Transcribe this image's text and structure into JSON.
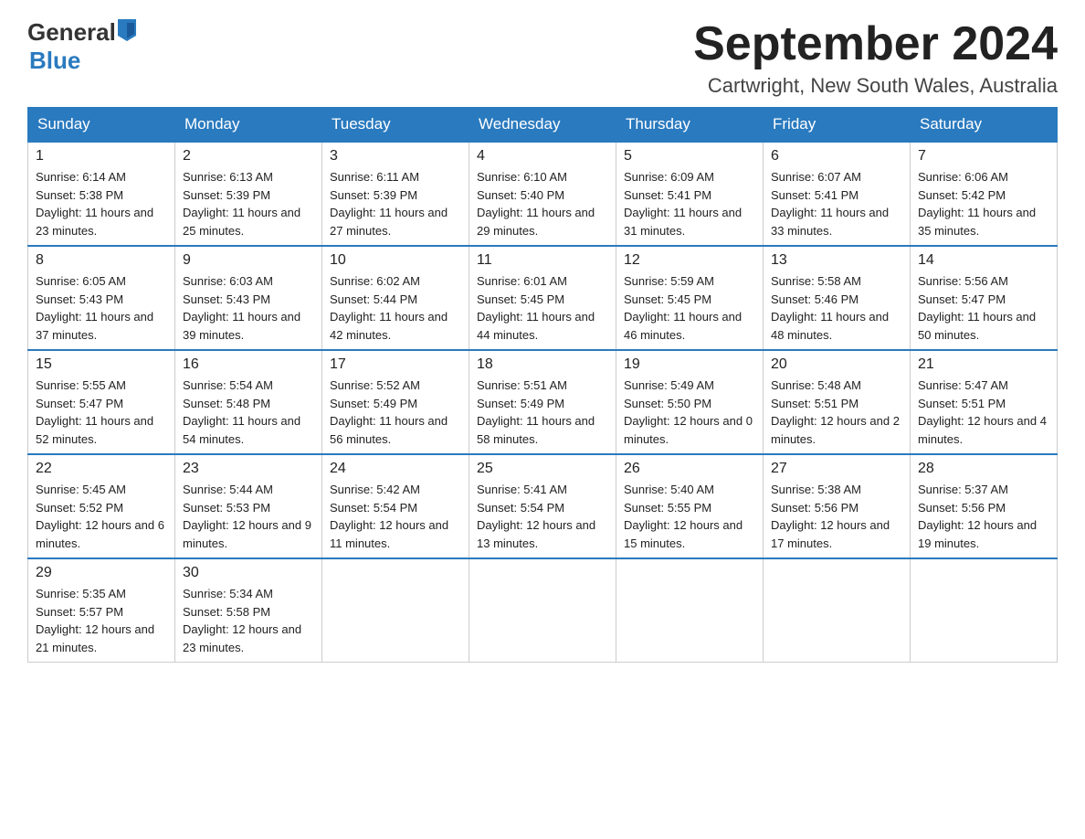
{
  "header": {
    "logo_general": "General",
    "logo_blue": "Blue",
    "month_title": "September 2024",
    "location": "Cartwright, New South Wales, Australia"
  },
  "weekdays": [
    "Sunday",
    "Monday",
    "Tuesday",
    "Wednesday",
    "Thursday",
    "Friday",
    "Saturday"
  ],
  "weeks": [
    [
      {
        "day": "1",
        "sunrise": "6:14 AM",
        "sunset": "5:38 PM",
        "daylight": "11 hours and 23 minutes."
      },
      {
        "day": "2",
        "sunrise": "6:13 AM",
        "sunset": "5:39 PM",
        "daylight": "11 hours and 25 minutes."
      },
      {
        "day": "3",
        "sunrise": "6:11 AM",
        "sunset": "5:39 PM",
        "daylight": "11 hours and 27 minutes."
      },
      {
        "day": "4",
        "sunrise": "6:10 AM",
        "sunset": "5:40 PM",
        "daylight": "11 hours and 29 minutes."
      },
      {
        "day": "5",
        "sunrise": "6:09 AM",
        "sunset": "5:41 PM",
        "daylight": "11 hours and 31 minutes."
      },
      {
        "day": "6",
        "sunrise": "6:07 AM",
        "sunset": "5:41 PM",
        "daylight": "11 hours and 33 minutes."
      },
      {
        "day": "7",
        "sunrise": "6:06 AM",
        "sunset": "5:42 PM",
        "daylight": "11 hours and 35 minutes."
      }
    ],
    [
      {
        "day": "8",
        "sunrise": "6:05 AM",
        "sunset": "5:43 PM",
        "daylight": "11 hours and 37 minutes."
      },
      {
        "day": "9",
        "sunrise": "6:03 AM",
        "sunset": "5:43 PM",
        "daylight": "11 hours and 39 minutes."
      },
      {
        "day": "10",
        "sunrise": "6:02 AM",
        "sunset": "5:44 PM",
        "daylight": "11 hours and 42 minutes."
      },
      {
        "day": "11",
        "sunrise": "6:01 AM",
        "sunset": "5:45 PM",
        "daylight": "11 hours and 44 minutes."
      },
      {
        "day": "12",
        "sunrise": "5:59 AM",
        "sunset": "5:45 PM",
        "daylight": "11 hours and 46 minutes."
      },
      {
        "day": "13",
        "sunrise": "5:58 AM",
        "sunset": "5:46 PM",
        "daylight": "11 hours and 48 minutes."
      },
      {
        "day": "14",
        "sunrise": "5:56 AM",
        "sunset": "5:47 PM",
        "daylight": "11 hours and 50 minutes."
      }
    ],
    [
      {
        "day": "15",
        "sunrise": "5:55 AM",
        "sunset": "5:47 PM",
        "daylight": "11 hours and 52 minutes."
      },
      {
        "day": "16",
        "sunrise": "5:54 AM",
        "sunset": "5:48 PM",
        "daylight": "11 hours and 54 minutes."
      },
      {
        "day": "17",
        "sunrise": "5:52 AM",
        "sunset": "5:49 PM",
        "daylight": "11 hours and 56 minutes."
      },
      {
        "day": "18",
        "sunrise": "5:51 AM",
        "sunset": "5:49 PM",
        "daylight": "11 hours and 58 minutes."
      },
      {
        "day": "19",
        "sunrise": "5:49 AM",
        "sunset": "5:50 PM",
        "daylight": "12 hours and 0 minutes."
      },
      {
        "day": "20",
        "sunrise": "5:48 AM",
        "sunset": "5:51 PM",
        "daylight": "12 hours and 2 minutes."
      },
      {
        "day": "21",
        "sunrise": "5:47 AM",
        "sunset": "5:51 PM",
        "daylight": "12 hours and 4 minutes."
      }
    ],
    [
      {
        "day": "22",
        "sunrise": "5:45 AM",
        "sunset": "5:52 PM",
        "daylight": "12 hours and 6 minutes."
      },
      {
        "day": "23",
        "sunrise": "5:44 AM",
        "sunset": "5:53 PM",
        "daylight": "12 hours and 9 minutes."
      },
      {
        "day": "24",
        "sunrise": "5:42 AM",
        "sunset": "5:54 PM",
        "daylight": "12 hours and 11 minutes."
      },
      {
        "day": "25",
        "sunrise": "5:41 AM",
        "sunset": "5:54 PM",
        "daylight": "12 hours and 13 minutes."
      },
      {
        "day": "26",
        "sunrise": "5:40 AM",
        "sunset": "5:55 PM",
        "daylight": "12 hours and 15 minutes."
      },
      {
        "day": "27",
        "sunrise": "5:38 AM",
        "sunset": "5:56 PM",
        "daylight": "12 hours and 17 minutes."
      },
      {
        "day": "28",
        "sunrise": "5:37 AM",
        "sunset": "5:56 PM",
        "daylight": "12 hours and 19 minutes."
      }
    ],
    [
      {
        "day": "29",
        "sunrise": "5:35 AM",
        "sunset": "5:57 PM",
        "daylight": "12 hours and 21 minutes."
      },
      {
        "day": "30",
        "sunrise": "5:34 AM",
        "sunset": "5:58 PM",
        "daylight": "12 hours and 23 minutes."
      },
      null,
      null,
      null,
      null,
      null
    ]
  ]
}
